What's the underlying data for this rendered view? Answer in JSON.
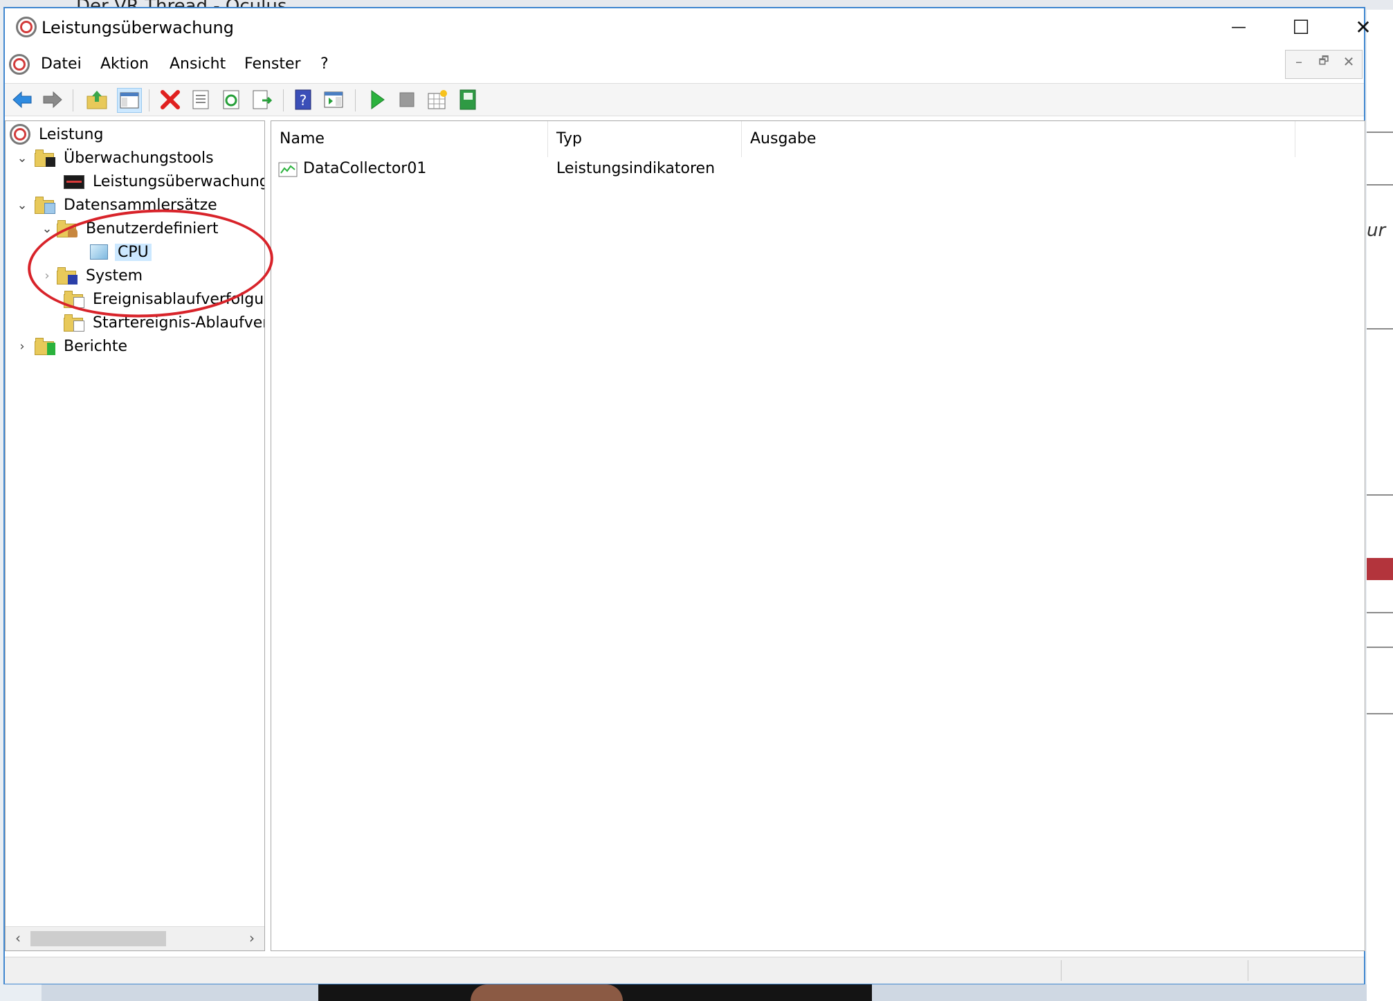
{
  "background": {
    "browser_tab": "Der VR Thread - Oculus",
    "side_text": "ur"
  },
  "window": {
    "title": "Leistungsüberwachung",
    "controls": {
      "minimize": "—",
      "maximize": "☐",
      "close": "✕"
    },
    "mdi_controls": {
      "minimize": "–",
      "restore": "🗗",
      "close": "✕"
    }
  },
  "menu": {
    "datei": "Datei",
    "aktion": "Aktion",
    "ansicht": "Ansicht",
    "fenster": "Fenster",
    "help": "?"
  },
  "tree": {
    "items": [
      {
        "label": "Leistung"
      },
      {
        "label": "Überwachungstools"
      },
      {
        "label": "Leistungsüberwachung"
      },
      {
        "label": "Datensammlersätze"
      },
      {
        "label": "Benutzerdefiniert"
      },
      {
        "label": "CPU"
      },
      {
        "label": "System"
      },
      {
        "label": "Ereignisablaufverfolgun"
      },
      {
        "label": "Startereignis-Ablaufverf"
      },
      {
        "label": "Berichte"
      }
    ]
  },
  "list": {
    "columns": {
      "name": "Name",
      "typ": "Typ",
      "ausgabe": "Ausgabe"
    },
    "rows": [
      {
        "name": "DataCollector01",
        "typ": "Leistungsindikatoren",
        "ausgabe": ""
      }
    ]
  },
  "colors": {
    "accent_border": "#3f86cf",
    "selection": "#cce8ff",
    "annotation": "#d8232a"
  }
}
